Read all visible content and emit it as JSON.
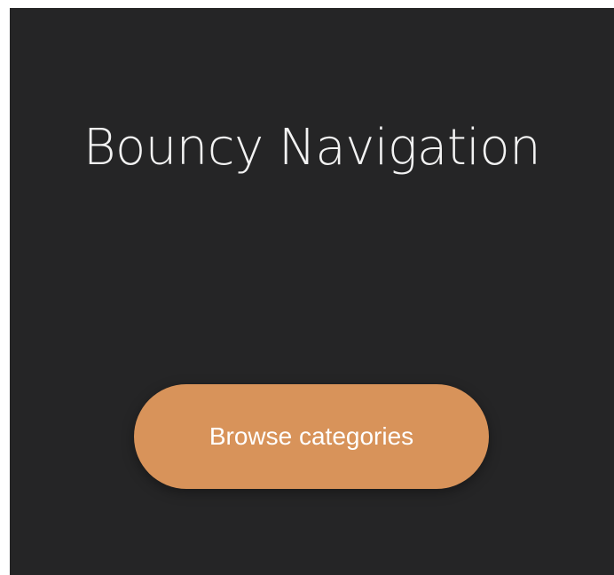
{
  "page": {
    "title": "Bouncy Navigation",
    "cta_label": "Browse categories"
  },
  "colors": {
    "background": "#252526",
    "title_text": "#f2f2f2",
    "cta_background": "#d8935a",
    "cta_text": "#ffffff"
  }
}
